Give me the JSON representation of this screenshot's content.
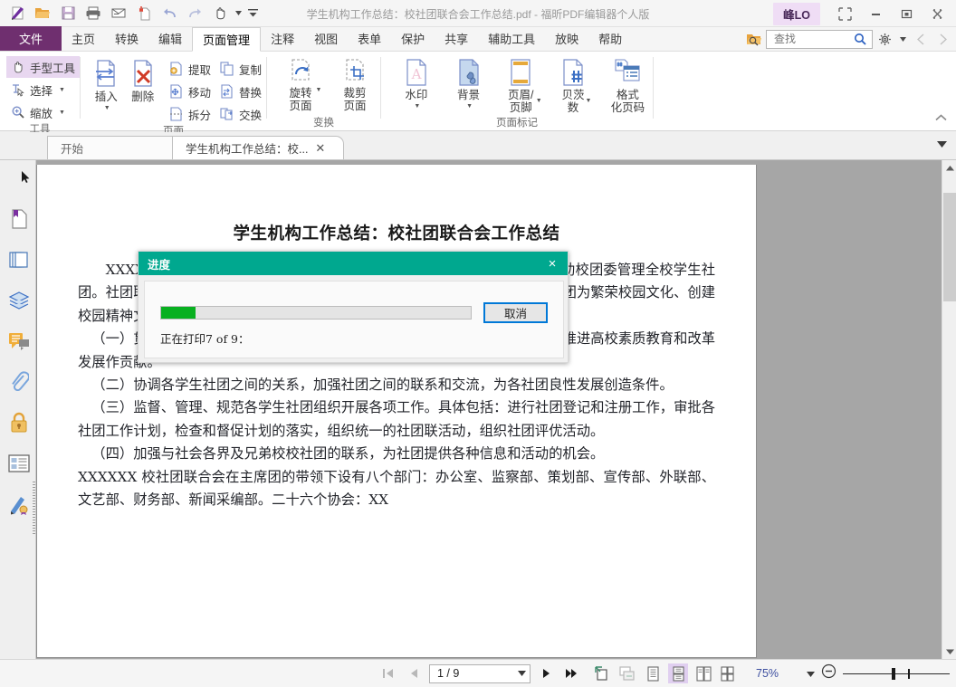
{
  "window": {
    "title": "学生机构工作总结：校社团联合会工作总结.pdf - 福昕PDF编辑器个人版",
    "user_chip": "峰LO",
    "quick_access": [
      {
        "name": "new-document-icon",
        "label": "新建"
      },
      {
        "name": "open-folder-icon",
        "label": "打开"
      },
      {
        "name": "save-icon",
        "label": "保存"
      },
      {
        "name": "print-icon",
        "label": "打印"
      },
      {
        "name": "email-icon",
        "label": "邮件"
      },
      {
        "name": "new-from-template-icon",
        "label": "从模板新建"
      },
      {
        "name": "undo-icon",
        "label": "撤销"
      },
      {
        "name": "redo-icon",
        "label": "重做"
      },
      {
        "name": "hand-tool-icon",
        "label": "手型工具"
      },
      {
        "name": "customize-qat-icon",
        "label": "自定义快速访问工具栏"
      }
    ],
    "controls": {
      "fullscreen": "全屏",
      "minimize": "最小化",
      "maximize": "最大化",
      "close": "关闭"
    }
  },
  "menubar": {
    "file": "文件",
    "items": [
      {
        "label": "主页",
        "active": false
      },
      {
        "label": "转换",
        "active": false
      },
      {
        "label": "编辑",
        "active": false
      },
      {
        "label": "页面管理",
        "active": true
      },
      {
        "label": "注释",
        "active": false
      },
      {
        "label": "视图",
        "active": false
      },
      {
        "label": "表单",
        "active": false
      },
      {
        "label": "保护",
        "active": false
      },
      {
        "label": "共享",
        "active": false
      },
      {
        "label": "辅助工具",
        "active": false
      },
      {
        "label": "放映",
        "active": false
      },
      {
        "label": "帮助",
        "active": false
      }
    ],
    "search": {
      "placeholder": "查找",
      "value": ""
    }
  },
  "ribbon": {
    "groups": [
      {
        "label": "工具",
        "small_buttons": [
          {
            "label": "手型工具",
            "icon": "hand-icon",
            "selected": true,
            "caret": false
          },
          {
            "label": "选择",
            "icon": "text-select-icon",
            "selected": false,
            "caret": true
          },
          {
            "label": "缩放",
            "icon": "zoom-in-icon",
            "selected": false,
            "caret": true
          }
        ]
      },
      {
        "label": "页面",
        "big_buttons": [
          {
            "label": "插入",
            "icon": "insert-page-icon",
            "caret": true
          },
          {
            "label": "删除",
            "icon": "delete-page-icon",
            "caret": false
          }
        ],
        "small_buttons": [
          {
            "label": "提取",
            "icon": "extract-page-icon"
          },
          {
            "label": "复制",
            "icon": "copy-page-icon"
          },
          {
            "label": "移动",
            "icon": "move-page-icon"
          },
          {
            "label": "替换",
            "icon": "replace-page-icon"
          },
          {
            "label": "拆分",
            "icon": "split-page-icon"
          },
          {
            "label": "交换",
            "icon": "swap-page-icon"
          }
        ]
      },
      {
        "label": "变换",
        "big_buttons": [
          {
            "label": "旋转\n页面",
            "icon": "rotate-page-icon",
            "caret": true
          },
          {
            "label": "裁剪\n页面",
            "icon": "crop-page-icon",
            "caret": false
          }
        ]
      },
      {
        "label": "页面标记",
        "big_buttons": [
          {
            "label": "水印",
            "icon": "watermark-icon",
            "caret": true
          },
          {
            "label": "背景",
            "icon": "background-icon",
            "caret": true
          },
          {
            "label": "页眉/\n页脚",
            "icon": "header-footer-icon",
            "caret": true
          },
          {
            "label": "贝茨\n数",
            "icon": "bates-number-icon",
            "caret": true
          },
          {
            "label": "格式\n化页码",
            "icon": "format-page-number-icon",
            "caret": false
          }
        ]
      }
    ],
    "collapse_label": "折叠功能区"
  },
  "doc_tabs": [
    {
      "label": "开始",
      "active": false,
      "closable": false
    },
    {
      "label": "学生机构工作总结：校...",
      "active": true,
      "closable": true
    }
  ],
  "left_panel": {
    "items": [
      {
        "name": "pointer-arrow-icon",
        "label": "展开面板"
      },
      {
        "name": "bookmark-icon",
        "label": "书签"
      },
      {
        "name": "page-thumbnails-icon",
        "label": "页面缩略图"
      },
      {
        "name": "layers-icon",
        "label": "图层"
      },
      {
        "name": "comments-icon",
        "label": "注释"
      },
      {
        "name": "attachments-icon",
        "label": "附件"
      },
      {
        "name": "security-lock-icon",
        "label": "安全"
      },
      {
        "name": "fields-icon",
        "label": "字段"
      },
      {
        "name": "digital-signature-icon",
        "label": "数字签名"
      }
    ]
  },
  "document": {
    "title": "学生机构工作总结：校社团联合会工作总结",
    "paragraphs": [
      "XXXXXX 校社团联合会是校团委领导下的学生组织，接受校团委领导，协助校团委管理全校学生社团。社团联的宗旨是培养学生的综合素质，引导学生社团健康发展，协助学生社团为繁荣校园文化、创建校园精神文明作出更大贡献。社团联的基本任务：",
      "（一）贯彻各级部门关于学生社团建设的重要指示，服务于学校中心工作，为推进高校素质教育和改革发展作贡献。",
      "（二）协调各学生社团之间的关系，加强社团之间的联系和交流，为各社团良性发展创造条件。",
      "（三）监督、管理、规范各学生社团组织开展各项工作。具体包括：进行社团登记和注册工作，审批各社团工作计划，检查和督促计划的落实，组织统一的社团联活动，组织社团评优活动。",
      "（四）加强与社会各界及兄弟校校社团的联系，为社团提供各种信息和活动的机会。",
      "XXXXXX 校社团联合会在主席团的带领下设有八个部门：办公室、监察部、策划部、宣传部、外联部、文艺部、财务部、新闻采编部。二十六个协会：XX"
    ]
  },
  "statusbar": {
    "first_page": "第一页",
    "prev_page": "上一页",
    "page_value": "1 / 9",
    "next_page": "下一页",
    "last_page": "最后一页",
    "fit_page": "适合页面",
    "fit_width": "适合宽度",
    "view_modes": [
      {
        "name": "single-page-view-icon",
        "label": "单页视图",
        "selected": false
      },
      {
        "name": "continuous-scroll-view-icon",
        "label": "连续滚动",
        "selected": true
      },
      {
        "name": "two-page-view-icon",
        "label": "双页视图",
        "selected": false
      },
      {
        "name": "two-page-continuous-view-icon",
        "label": "双页连续",
        "selected": false
      }
    ],
    "zoom_value": "75%",
    "zoom_out": "缩小",
    "zoom_in": "放大",
    "resize_grip": "调整大小"
  },
  "dialog": {
    "title": "进度",
    "close_label": "×",
    "progress_percent": 11,
    "cancel_label": "取消",
    "status_text": "正在打印7 of 9："
  },
  "colors": {
    "accent_purple": "#6f2f6f",
    "dialog_teal": "#00a88f",
    "progress_green": "#08b020",
    "focus_blue": "#0078d7",
    "selected_lavender": "#e8d7f0"
  }
}
